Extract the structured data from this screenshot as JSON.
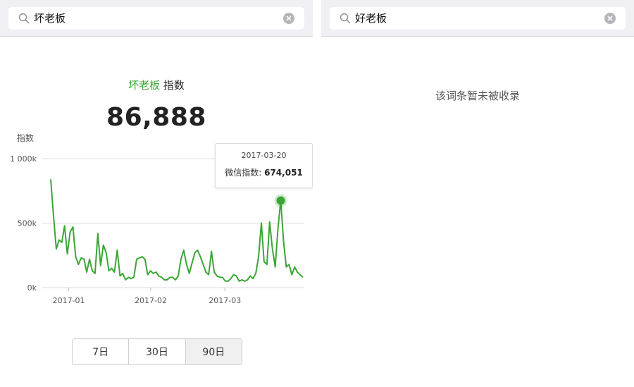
{
  "left": {
    "search": {
      "query": "坏老板"
    },
    "index_title": {
      "keyword": "坏老板",
      "suffix": "指数"
    },
    "total_value": "86,888",
    "chart_data": {
      "type": "line",
      "ylabel": "指数",
      "y_ticks": [
        "1 000k",
        "500k",
        "0k"
      ],
      "ylim": [
        0,
        1000000
      ],
      "x_ticks": [
        "2017-01",
        "2017-02",
        "2017-03"
      ],
      "x_start": "2016-12-22",
      "x_end": "2017-03-31",
      "grid": true,
      "color": "#3aa635",
      "values": [
        840000,
        560000,
        300000,
        370000,
        350000,
        480000,
        260000,
        430000,
        470000,
        240000,
        180000,
        230000,
        220000,
        120000,
        220000,
        130000,
        110000,
        420000,
        170000,
        330000,
        270000,
        130000,
        150000,
        120000,
        290000,
        90000,
        110000,
        60000,
        80000,
        70000,
        80000,
        220000,
        230000,
        240000,
        220000,
        100000,
        130000,
        110000,
        120000,
        90000,
        80000,
        60000,
        60000,
        80000,
        80000,
        60000,
        90000,
        220000,
        290000,
        180000,
        110000,
        190000,
        270000,
        290000,
        240000,
        180000,
        120000,
        100000,
        280000,
        120000,
        90000,
        80000,
        80000,
        50000,
        50000,
        70000,
        100000,
        90000,
        50000,
        60000,
        50000,
        60000,
        90000,
        70000,
        110000,
        240000,
        500000,
        200000,
        180000,
        510000,
        300000,
        160000,
        460000,
        674051,
        360000,
        160000,
        180000,
        100000,
        160000,
        120000,
        100000,
        80000
      ],
      "highlight": {
        "date": "2017-03-20",
        "label": "微信指数:",
        "value_text": "674,051",
        "value": 674051
      }
    },
    "ranges": [
      {
        "label": "7日",
        "active": false
      },
      {
        "label": "30日",
        "active": false
      },
      {
        "label": "90日",
        "active": true
      }
    ]
  },
  "right": {
    "search": {
      "query": "好老板"
    },
    "empty_message": "该词条暂未被收录"
  }
}
